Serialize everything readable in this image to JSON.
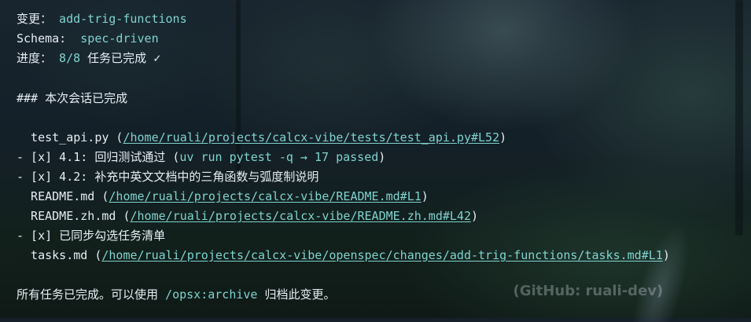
{
  "terminal": {
    "change_label": "变更：",
    "change_value": "add-trig-functions",
    "schema_label": "Schema:",
    "schema_value": "spec-driven",
    "progress_label": "进度：",
    "progress_value": "8/8",
    "progress_text": "任务已完成",
    "progress_check": "✓",
    "heading": "### 本次会话已完成",
    "lines": [
      {
        "prefix": "  test_api.py (",
        "link": "/home/ruali/projects/calcx-vibe/tests/test_api.py#L52",
        "suffix": ")"
      },
      {
        "prefix": "- [x] 4.1: 回归测试通过 (",
        "code": "uv run pytest -q → 17 passed",
        "suffix": ")"
      },
      {
        "prefix": "- [x] 4.2: 补充中英文文档中的三角函数与弧度制说明"
      },
      {
        "prefix": "  README.md (",
        "link": "/home/ruali/projects/calcx-vibe/README.md#L1",
        "suffix": ")"
      },
      {
        "prefix": "  README.zh.md (",
        "link": "/home/ruali/projects/calcx-vibe/README.zh.md#L42",
        "suffix": ")"
      },
      {
        "prefix": "- [x] 已同步勾选任务清单"
      },
      {
        "prefix": "  tasks.md (",
        "link": "/home/ruali/projects/calcx-vibe/openspec/changes/add-trig-functions/tasks.md#L1",
        "suffix": ")"
      }
    ],
    "final_before": "所有任务已完成。可以使用 ",
    "final_code": "/opsx:archive",
    "final_after": " 归档此变更。"
  },
  "watermark": "  (GitHub: ruali-dev)",
  "colors": {
    "accent": "#7fd3cf",
    "text": "#e6edf3",
    "background": "#15202a"
  }
}
